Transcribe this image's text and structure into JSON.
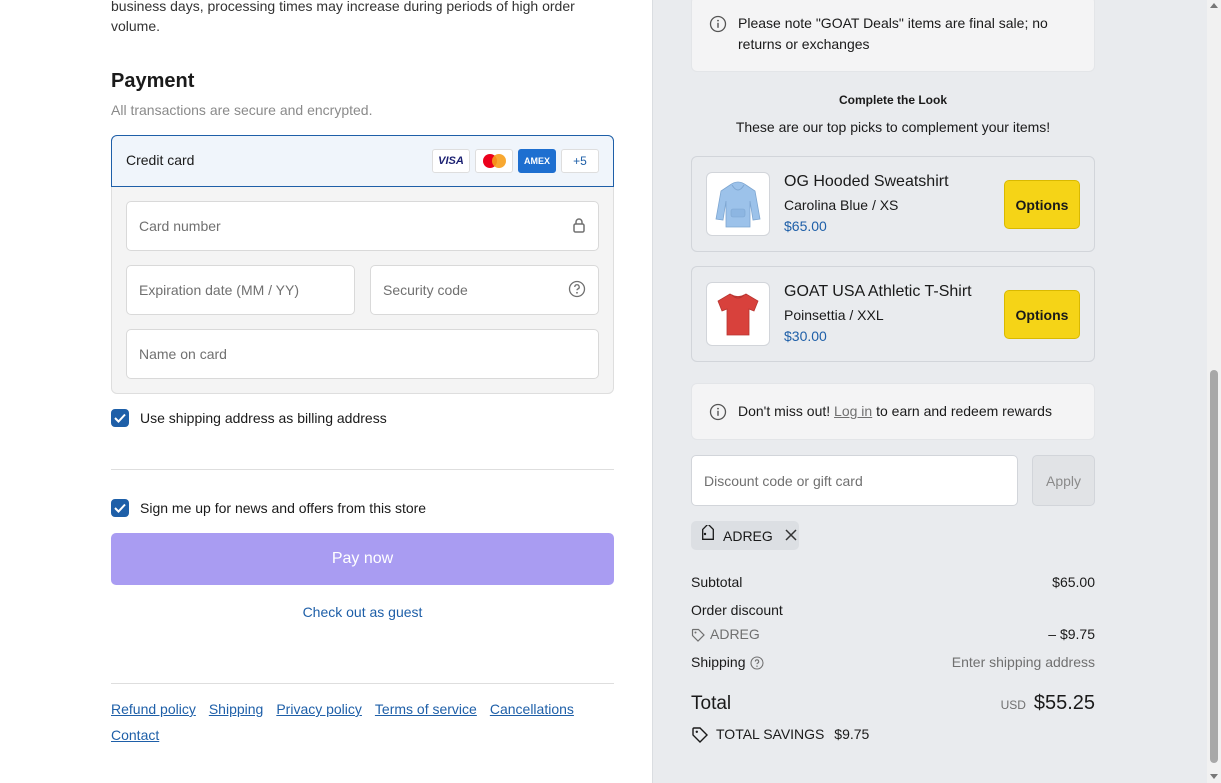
{
  "checkout": {
    "shipping_note": "business days, processing times may increase during periods of high order volume.",
    "payment": {
      "title": "Payment",
      "subtitle": "All transactions are secure and encrypted.",
      "method_label": "Credit card",
      "card_brands": [
        "VISA",
        "",
        "AMEX",
        "+5"
      ],
      "card_number_placeholder": "Card number",
      "expiration_placeholder": "Expiration date (MM / YY)",
      "security_code_placeholder": "Security code",
      "name_on_card_placeholder": "Name on card"
    },
    "billing_checkbox_label": "Use shipping address as billing address",
    "billing_checked": true,
    "news_checkbox_label": "Sign me up for news and offers from this store",
    "news_checked": true,
    "pay_button_label": "Pay now",
    "guest_link": "Check out as guest",
    "footer_links": [
      "Refund policy",
      "Shipping",
      "Privacy policy",
      "Terms of service",
      "Cancellations",
      "Contact"
    ]
  },
  "summary": {
    "deals_note": "Please note \"GOAT Deals\" items are final sale; no returns or exchanges",
    "complete_the_look_title": "Complete the Look",
    "complete_the_look_subtitle": "These are our top picks to complement your items!",
    "products": [
      {
        "name": "OG Hooded Sweatshirt",
        "variant": "Carolina Blue / XS",
        "price": "$65.00",
        "button": "Options",
        "color": "#9cc2ea"
      },
      {
        "name": "GOAT USA Athletic T-Shirt",
        "variant": "Poinsettia / XXL",
        "price": "$30.00",
        "button": "Options",
        "color": "#d8413c"
      }
    ],
    "rewards": {
      "prefix": "Don't miss out! ",
      "link": "Log in",
      "suffix": " to earn and redeem rewards"
    },
    "discount_placeholder": "Discount code or gift card",
    "apply_label": "Apply",
    "applied_code": "ADREG",
    "subtotal_label": "Subtotal",
    "subtotal_value": "$65.00",
    "order_discount_label": "Order discount",
    "discount_code": "ADREG",
    "discount_value": "– $9.75",
    "shipping_label": "Shipping",
    "shipping_value": "Enter shipping address",
    "total_label": "Total",
    "total_currency": "USD",
    "total_value": "$55.25",
    "savings_label": "TOTAL SAVINGS",
    "savings_value": "$9.75"
  },
  "colors": {
    "accent": "#1e5fa8",
    "pay_button": "#a99cf2",
    "options_button": "#f5d417"
  }
}
